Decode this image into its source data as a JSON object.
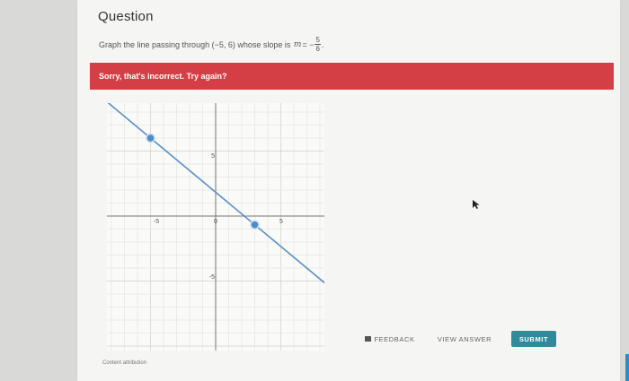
{
  "question": {
    "heading": "Question",
    "prompt_prefix": "Graph the line passing through (−5, 6) whose slope is",
    "slope_var": "m",
    "equals": "= −",
    "slope_num": "5",
    "slope_den": "6",
    "prompt_suffix": "."
  },
  "feedback": {
    "message": "Sorry, that's incorrect. Try again?",
    "color": "#d33f45"
  },
  "graph": {
    "tick_labels": {
      "x_neg": "-5",
      "origin": "0",
      "x_pos": "5",
      "y_pos": "5",
      "y_neg": "-5"
    },
    "points": [
      {
        "x": -5,
        "y": 6
      },
      {
        "x": 3,
        "y": -0.67
      }
    ],
    "line_color": "#5a8fc6",
    "point_color": "#4f8bc9"
  },
  "actions": {
    "feedback_label": "FEEDBACK",
    "view_answer_label": "VIEW ANSWER",
    "submit_label": "SUBMIT",
    "accent": "#2f8a9c"
  },
  "footer": {
    "attribution": "Content attribution"
  }
}
